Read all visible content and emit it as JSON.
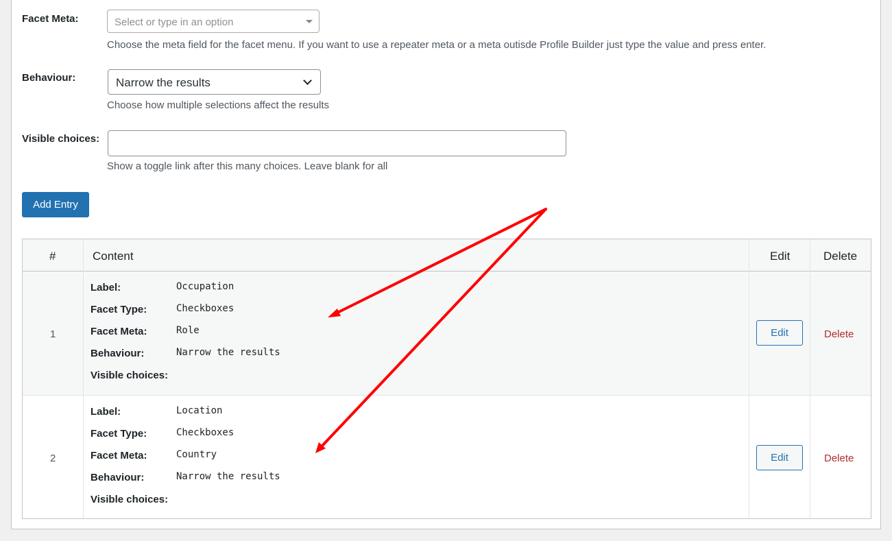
{
  "form": {
    "facet_meta": {
      "label": "Facet Meta:",
      "placeholder": "Select or type in an option",
      "description": "Choose the meta field for the facet menu. If you want to use a repeater meta or a meta outisde Profile Builder just type the value and press enter."
    },
    "behaviour": {
      "label": "Behaviour:",
      "value": "Narrow the results",
      "description": "Choose how multiple selections affect the results"
    },
    "visible_choices": {
      "label": "Visible choices:",
      "value": "",
      "description": "Show a toggle link after this many choices. Leave blank for all"
    },
    "add_entry_label": "Add Entry"
  },
  "table": {
    "headers": {
      "num": "#",
      "content": "Content",
      "edit": "Edit",
      "delete": "Delete"
    },
    "field_labels": {
      "label": "Label:",
      "facet_type": "Facet Type:",
      "facet_meta": "Facet Meta:",
      "behaviour": "Behaviour:",
      "visible_choices": "Visible choices:"
    },
    "rows": [
      {
        "num": "1",
        "label": "Occupation",
        "facet_type": "Checkboxes",
        "facet_meta": "Role",
        "behaviour": "Narrow the results",
        "visible_choices": "",
        "edit_label": "Edit",
        "delete_label": "Delete"
      },
      {
        "num": "2",
        "label": "Location",
        "facet_type": "Checkboxes",
        "facet_meta": "Country",
        "behaviour": "Narrow the results",
        "visible_choices": "",
        "edit_label": "Edit",
        "delete_label": "Delete"
      }
    ]
  },
  "colors": {
    "primary": "#2271b1",
    "delete": "#b32d2e",
    "annotation_arrow": "#ff0000"
  }
}
